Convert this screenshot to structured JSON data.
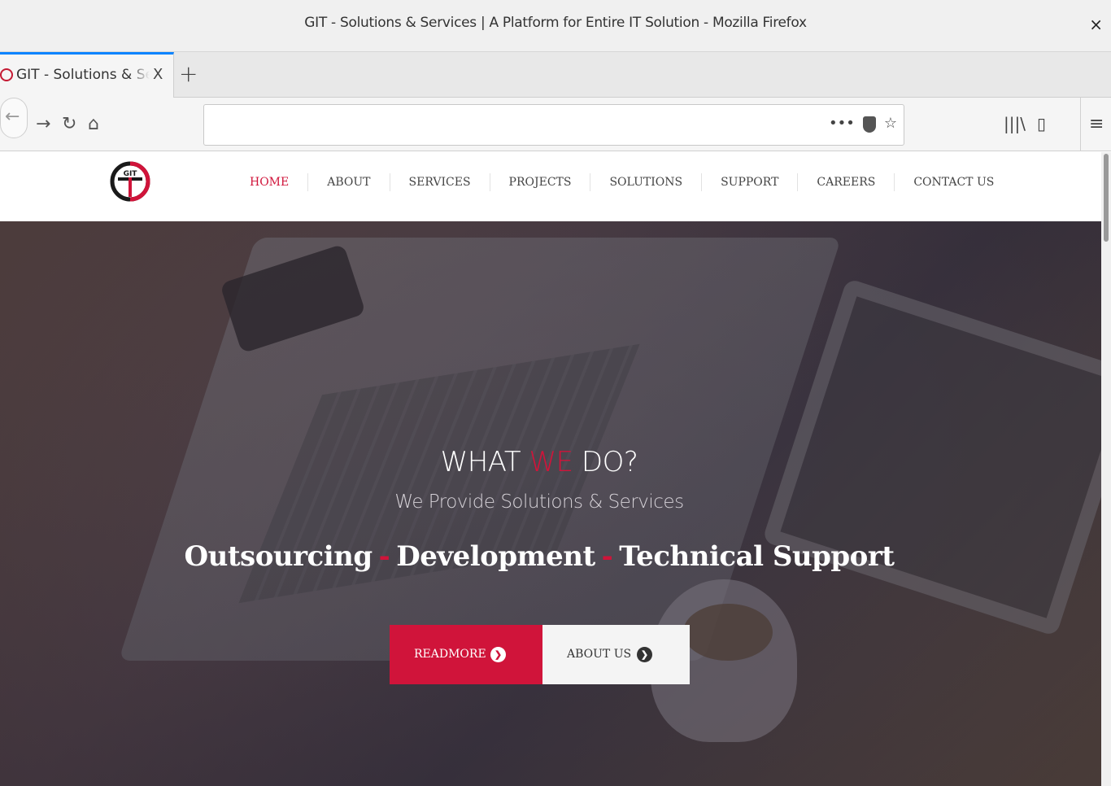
{
  "window": {
    "title": "GIT - Solutions & Services | A Platform for Entire IT Solution - Mozilla Firefox",
    "close_label": "×"
  },
  "tabs": [
    {
      "label": "GIT - Solutions & Services | A Platform for Entire IT Solution",
      "close": "X",
      "active": true
    }
  ],
  "newtab_label": "+",
  "toolbar": {
    "back": "←",
    "forward": "→",
    "reload": "↻",
    "home": "⌂",
    "url": "",
    "page_actions": "•••",
    "bookmark": "☆",
    "library": "|||\\",
    "sidebar": "▯",
    "menu": "≡"
  },
  "site": {
    "logo_text": "GIT",
    "nav": [
      {
        "label": "HOME",
        "active": true
      },
      {
        "label": "ABOUT"
      },
      {
        "label": "SERVICES"
      },
      {
        "label": "PROJECTS"
      },
      {
        "label": "SOLUTIONS"
      },
      {
        "label": "SUPPORT"
      },
      {
        "label": "CAREERS"
      },
      {
        "label": "CONTACT US"
      }
    ],
    "hero": {
      "title_pre": "WHAT ",
      "title_accent": "WE",
      "title_post": " DO?",
      "subtitle": "We Provide Solutions & Services",
      "services": [
        "Outsourcing",
        "Development",
        "Technical Support"
      ],
      "separator": "-",
      "buttons": {
        "readmore": "READMORE",
        "about": "ABOUT US",
        "arrow": "❯"
      }
    }
  },
  "colors": {
    "accent": "#d0143a",
    "text": "#444444",
    "button_light": "#f4f4f4"
  }
}
